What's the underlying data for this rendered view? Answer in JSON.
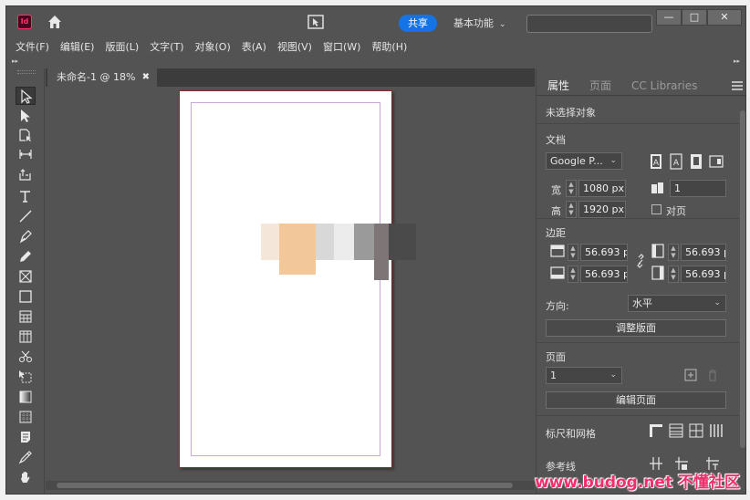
{
  "titlebar": {
    "app_logo_text": "Id",
    "share_label": "共享",
    "workspace_label": "基本功能",
    "window_min": "—",
    "window_max": "□",
    "window_close": "✕"
  },
  "menu": [
    "文件(F)",
    "编辑(E)",
    "版面(L)",
    "文字(T)",
    "对象(O)",
    "表(A)",
    "视图(V)",
    "窗口(W)",
    "帮助(H)"
  ],
  "document_tab": {
    "title": "未命名-1 @ 18%",
    "close_glyph": "✖"
  },
  "panel": {
    "tabs": [
      "属性",
      "页面",
      "CC Libraries"
    ],
    "active_tab": "属性",
    "no_selection": "未选择对象",
    "document_section": "文档",
    "preset": "Google P...",
    "width_label": "宽",
    "width_value": "1080 px",
    "height_label": "高",
    "height_value": "1920 px",
    "pages_value": "1",
    "facing_pages": "对页",
    "margins_section": "边距",
    "margin_top": "56.693 p",
    "margin_bottom": "56.693 p",
    "margin_inside": "56.693 p",
    "margin_outside": "56.693 p",
    "orientation_label": "方向:",
    "orientation_value": "水平",
    "adjust_layout": "调整版面",
    "page_section": "页面",
    "page_value": "1",
    "edit_page": "编辑页面",
    "rulers_grids": "标尺和网格",
    "guides": "参考线"
  },
  "watermark": "www.budog.net 不懂社区",
  "colors": {
    "ui_bg": "#535353",
    "share_blue": "#1473e6",
    "page_border": "#8a2b2b",
    "margin_guide": "#c8a8d8"
  },
  "toolbar_icons": [
    "selection-tool-icon",
    "direct-selection-tool-icon",
    "page-tool-icon",
    "gap-tool-icon",
    "content-collector-icon",
    "type-tool-icon",
    "line-tool-icon",
    "pen-tool-icon",
    "pencil-tool-icon",
    "rectangle-frame-tool-icon",
    "rectangle-tool-icon",
    "table-tool-icon",
    "grid-tool-icon",
    "scissors-tool-icon",
    "free-transform-tool-icon",
    "gradient-swatch-tool-icon",
    "gradient-feather-tool-icon",
    "note-tool-icon",
    "eyedropper-tool-icon",
    "hand-tool-icon"
  ]
}
